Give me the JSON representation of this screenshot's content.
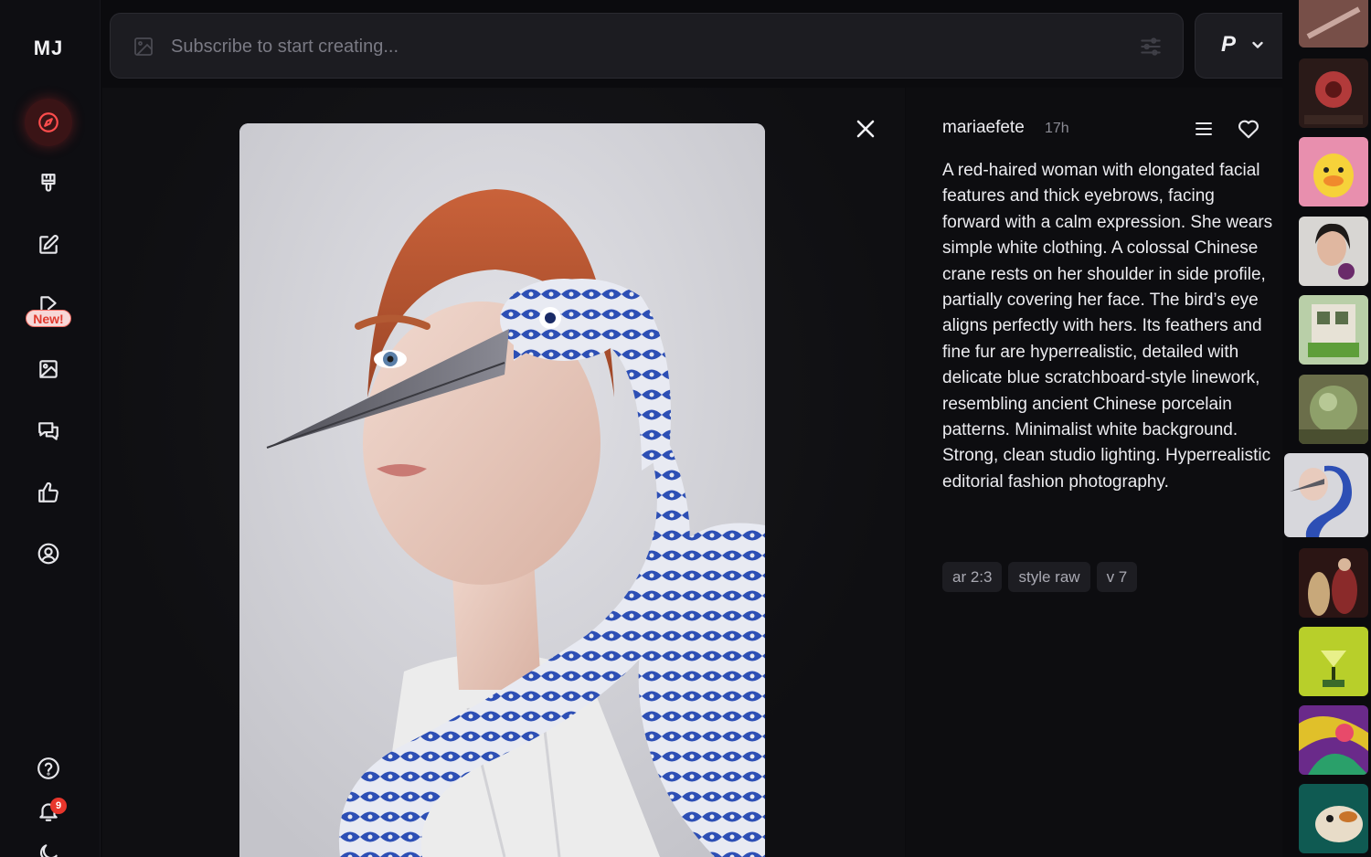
{
  "app": {
    "logo": "MJ"
  },
  "sidebar": {
    "items": [
      {
        "id": "explore",
        "icon": "compass-icon",
        "active": true
      },
      {
        "id": "create",
        "icon": "paintbrush-icon"
      },
      {
        "id": "edit",
        "icon": "edit-icon"
      },
      {
        "id": "video",
        "icon": "video-icon",
        "badge": "New!"
      },
      {
        "id": "organize",
        "icon": "image-icon"
      },
      {
        "id": "chat",
        "icon": "chat-icon"
      },
      {
        "id": "rate",
        "icon": "thumbs-up-icon"
      },
      {
        "id": "profile",
        "icon": "user-circle-icon"
      }
    ],
    "bottom": [
      {
        "id": "help",
        "icon": "help-icon"
      },
      {
        "id": "notifications",
        "icon": "bell-icon",
        "count": "9"
      },
      {
        "id": "theme",
        "icon": "moon-icon"
      }
    ]
  },
  "prompt_bar": {
    "placeholder": "Subscribe to start creating..."
  },
  "mode": {
    "label": "P"
  },
  "post": {
    "author": "mariaefete",
    "time": "17h",
    "prompt": "A red-haired woman with elongated facial features and thick eyebrows, facing forward with a calm expression. She wears simple white clothing. A colossal Chinese crane rests on her shoulder in side profile, partially covering her face. The bird’s eye aligns perfectly with hers. Its feathers and fine fur are hyperrealistic, detailed with delicate blue scratchboard-style linework, resembling ancient Chinese porcelain patterns. Minimalist white background. Strong, clean studio lighting. Hyperrealistic editorial fashion photography.",
    "tags": [
      "ar 2:3",
      "style raw",
      "v 7"
    ]
  },
  "colors": {
    "accent": "#ff4d4d",
    "badge": "#e8362c",
    "porcelain_blue": "#2c4fb8"
  }
}
